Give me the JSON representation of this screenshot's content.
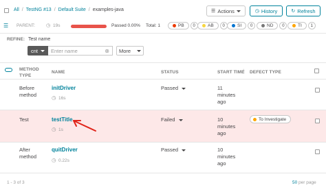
{
  "breadcrumb": {
    "items": [
      "All",
      "TestNG #13",
      "Default Suite",
      "examples-java"
    ]
  },
  "toolbar": {
    "actions_label": "Actions",
    "history_label": "History",
    "refresh_label": "Refresh"
  },
  "summary": {
    "parent_label": "PARENT:",
    "duration": "19s",
    "passed_text": "Passed 0.00%",
    "total_text": "Total: 1",
    "defect_badges": [
      {
        "code": "PB",
        "count": "0",
        "color": "#ec3900"
      },
      {
        "code": "AB",
        "count": "0",
        "color": "#f7d63e"
      },
      {
        "code": "SI",
        "count": "0",
        "color": "#0274d1"
      },
      {
        "code": "ND",
        "count": "0",
        "color": "#777777"
      },
      {
        "code": "TI",
        "count": "1",
        "color": "#ffa500"
      }
    ]
  },
  "refine": {
    "label": "REFINE:",
    "filter_label": "Test name",
    "condition": "cnt",
    "input_placeholder": "Enter name",
    "more_label": "More"
  },
  "table": {
    "headers": {
      "method_type": "METHOD TYPE",
      "name": "NAME",
      "status": "STATUS",
      "start_time": "START TIME",
      "defect_type": "DEFECT TYPE"
    },
    "rows": [
      {
        "method_type": "Before method",
        "name": "initDriver",
        "duration": "16s",
        "status": "Passed",
        "start_time": "11 minutes ago",
        "defect": ""
      },
      {
        "method_type": "Test",
        "name": "testTitle",
        "duration": "1s",
        "status": "Failed",
        "start_time": "10 minutes ago",
        "defect": "To Investigate"
      },
      {
        "method_type": "After method",
        "name": "quitDriver",
        "duration": "0.22s",
        "status": "Passed",
        "start_time": "10 minutes ago",
        "defect": ""
      }
    ]
  },
  "footer": {
    "range": "1 - 3 of 3",
    "per_page": "50",
    "per_page_suffix": "per page"
  },
  "colors": {
    "accent": "#00829b",
    "failed_row_bg": "#fde8e8",
    "progress_fail": "#e8534a",
    "annotation_arrow": "#e0241a",
    "to_investigate": "#ffa500"
  }
}
